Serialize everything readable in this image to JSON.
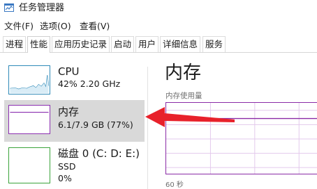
{
  "window": {
    "title": "任务管理器",
    "icon": "task-manager-icon"
  },
  "menu": [
    {
      "label": "文件(F)"
    },
    {
      "label": "选项(O)"
    },
    {
      "label": "查看(V)"
    }
  ],
  "tabs": [
    {
      "label": "进程"
    },
    {
      "label": "性能",
      "active": true
    },
    {
      "label": "应用历史记录"
    },
    {
      "label": "启动"
    },
    {
      "label": "用户"
    },
    {
      "label": "详细信息"
    },
    {
      "label": "服务"
    }
  ],
  "perf_list": [
    {
      "title": "CPU",
      "sub1": "42%  2.20 GHz",
      "color": "#2f8ab8"
    },
    {
      "title": "内存",
      "sub1": "6.1/7.9 GB (77%)",
      "color": "#8b2fb0",
      "selected": true
    },
    {
      "title": "磁盘 0 (C: D: E:)",
      "sub1": "SSD",
      "sub2": "0%",
      "color": "#3aa33a"
    }
  ],
  "detail": {
    "title": "内存",
    "chart_label": "内存使用量",
    "time_label": "60 秒",
    "accent": "#8a2aa6"
  },
  "annotation": {
    "arrow_color": "#e8212b"
  }
}
